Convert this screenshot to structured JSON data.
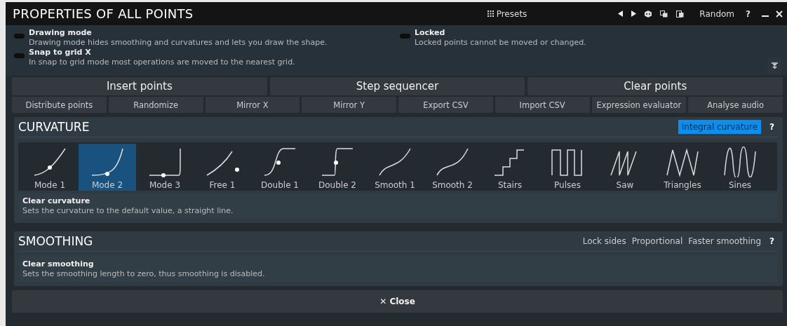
{
  "window": {
    "title": "PROPERTIES OF ALL POINTS",
    "presets": "Presets",
    "random": "Random",
    "help": "?"
  },
  "toggles": [
    {
      "label": "Drawing mode",
      "description": "Drawing mode hides smoothing and curvatures and lets you draw the shape.",
      "on": false
    },
    {
      "label": "Locked",
      "description": "Locked points cannot be moved or changed.",
      "on": false
    },
    {
      "label": "Snap to grid X",
      "description": "In snap to grid mode most operations are moved to the nearest grid.",
      "on": false
    }
  ],
  "main_buttons": [
    "Insert points",
    "Step sequencer",
    "Clear points"
  ],
  "tool_buttons": [
    "Distribute points",
    "Randomize",
    "Mirror X",
    "Mirror Y",
    "Export CSV",
    "Import CSV",
    "Expression evaluator",
    "Analyse audio"
  ],
  "curvature": {
    "title": "CURVATURE",
    "integral": {
      "label": "Integral curvature",
      "selected": true
    },
    "help": "?",
    "modes": [
      {
        "label": "Mode 1",
        "selected": false
      },
      {
        "label": "Mode 2",
        "selected": true
      },
      {
        "label": "Mode 3",
        "selected": false
      },
      {
        "label": "Free 1",
        "selected": false
      },
      {
        "label": "Double 1",
        "selected": false
      },
      {
        "label": "Double 2",
        "selected": false
      },
      {
        "label": "Smooth 1",
        "selected": false
      },
      {
        "label": "Smooth 2",
        "selected": false
      },
      {
        "label": "Stairs",
        "selected": false
      },
      {
        "label": "Pulses",
        "selected": false
      },
      {
        "label": "Saw",
        "selected": false
      },
      {
        "label": "Triangles",
        "selected": false
      },
      {
        "label": "Sines",
        "selected": false
      }
    ],
    "info": {
      "title": "Clear curvature",
      "text": "Sets the curvature to the default value, a straight line."
    }
  },
  "smoothing": {
    "title": "SMOOTHING",
    "options": [
      {
        "label": "Lock sides",
        "on": false
      },
      {
        "label": "Proportional",
        "on": false
      },
      {
        "label": "Faster smoothing",
        "on": false
      }
    ],
    "help": "?",
    "info": {
      "title": "Clear smoothing",
      "text": "Sets the smoothing length to zero, thus smoothing is disabled."
    }
  },
  "close_button": {
    "icon": "✕",
    "label": "Close"
  }
}
